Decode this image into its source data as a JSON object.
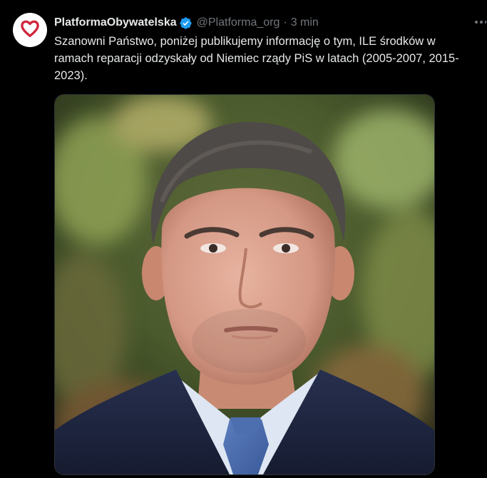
{
  "tweet": {
    "author": {
      "display_name": "PlatformaObywatelska",
      "handle": "@Platforma_org",
      "verified": true,
      "avatar_icon": "heart-logo-icon"
    },
    "separator": "·",
    "time": "3 min",
    "text": "Szanowni Państwo, poniżej publikujemy informację o tym, ILE środków w ramach reparacji odzyskały od Niemiec rządy PiS w latach (2005-2007, 2015-2023).",
    "media": {
      "type": "photo"
    }
  },
  "colors": {
    "background": "#000000",
    "text_primary": "#e7e9ea",
    "text_secondary": "#71767b",
    "verified_badge": "#1d9bf0",
    "logo_heart": "#d0273e"
  }
}
